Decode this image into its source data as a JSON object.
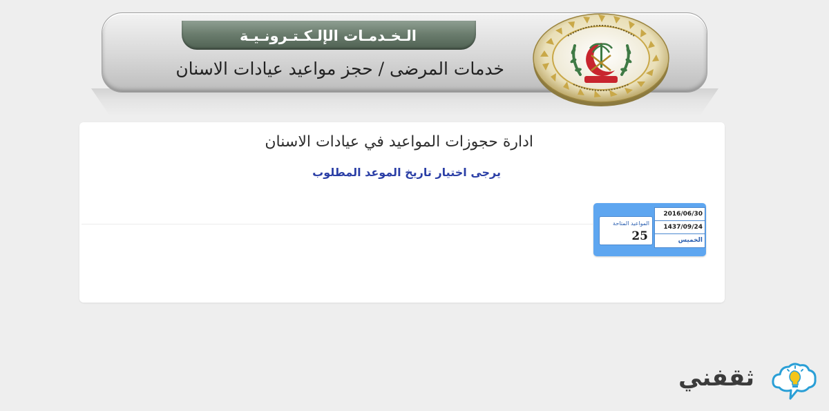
{
  "header": {
    "strip_title": "الـخـدمـات الإلـكـتـرونـيـة",
    "subtitle": "خدمات المرضى / حجز مواعيد عيادات الاسنان",
    "emblem_icon": "armed-forces-hospital-emblem-icon"
  },
  "content": {
    "title": "ادارة حجوزات المواعيد في عيادات الاسنان",
    "instruction": "يرجى اختيار تاريخ الموعد المطلوب"
  },
  "date_tile": {
    "gregorian_date": "2016/06/30",
    "hijri_date": "1437/09/24",
    "day_name": "الخميس",
    "available_label": "المواعيد المتاحة",
    "available_count": "25",
    "colors": {
      "tile": "#5ea6f0",
      "border": "#4c89cf"
    }
  },
  "watermark": {
    "text": "ثقفني",
    "icon": "lightbulb-cloud-icon"
  },
  "colors": {
    "strip": "#6b7d6e",
    "instruction": "#2b3fa6",
    "emblem_gold": "#c9a848",
    "emblem_green": "#3f7a45",
    "emblem_red": "#c8252e"
  }
}
